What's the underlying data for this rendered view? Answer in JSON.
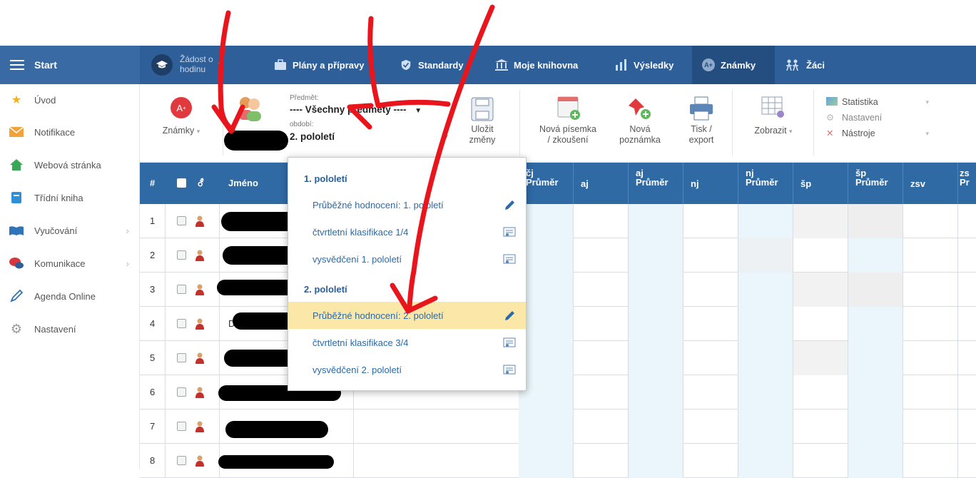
{
  "topbar": {
    "start": "Start",
    "lesson_request": "Žádost o hodinu",
    "nav": [
      {
        "label": "Plány a přípravy"
      },
      {
        "label": "Standardy"
      },
      {
        "label": "Moje knihovna"
      },
      {
        "label": "Výsledky"
      },
      {
        "label": "Známky"
      },
      {
        "label": "Žáci"
      }
    ]
  },
  "sidebar": {
    "items": [
      {
        "label": "Úvod"
      },
      {
        "label": "Notifikace"
      },
      {
        "label": "Webová stránka"
      },
      {
        "label": "Třídní kniha"
      },
      {
        "label": "Vyučování"
      },
      {
        "label": "Komunikace"
      },
      {
        "label": "Agenda Online"
      },
      {
        "label": "Nastavení"
      }
    ]
  },
  "ribbon": {
    "grades": "Známky",
    "subject_label": "Předmět:",
    "subject_value": "---- Všechny předměty ----",
    "period_label": "období:",
    "period_value": "2. pololetí",
    "save": [
      "Uložit",
      "změny"
    ],
    "new_test": [
      "Nová písemka",
      "/ zkoušení"
    ],
    "new_note": [
      "Nová",
      "poznámka"
    ],
    "print": [
      "Tisk /",
      "export"
    ],
    "show": "Zobrazit",
    "stats": "Statistika",
    "settings": "Nastavení",
    "tools": "Nástroje"
  },
  "grid": {
    "hash": "#",
    "gender": "⚦",
    "name": "Jméno",
    "columns": [
      {
        "top": "čj",
        "bottom": "Průměr"
      },
      {
        "top": "",
        "bottom": "aj"
      },
      {
        "top": "aj",
        "bottom": "Průměr"
      },
      {
        "top": "",
        "bottom": "nj"
      },
      {
        "top": "nj",
        "bottom": "Průměr"
      },
      {
        "top": "",
        "bottom": "šp"
      },
      {
        "top": "šp",
        "bottom": "Průměr"
      },
      {
        "top": "",
        "bottom": "zsv"
      },
      {
        "top": "zs",
        "bottom": "Pr"
      }
    ],
    "rows": [
      "1",
      "2",
      "3",
      "4",
      "5",
      "6",
      "7",
      "8"
    ],
    "row4_initial": "D"
  },
  "dropdown": {
    "group1": "1. pololetí",
    "group1_items": [
      "Průběžné hodnocení: 1. pololetí",
      "čtvrtletní klasifikace 1/4",
      "vysvědčení 1. pololetí"
    ],
    "group2": "2. pololetí",
    "group2_items": [
      "Průběžné hodnocení: 2. pololetí",
      "čtvrtletní klasifikace 3/4",
      "vysvědčení 2. pololetí"
    ]
  },
  "colors": {
    "topbar": "#2f5f99",
    "grid_header": "#2f6aa5",
    "selected": "#fbe7a8",
    "annotation": "#e8161c"
  }
}
